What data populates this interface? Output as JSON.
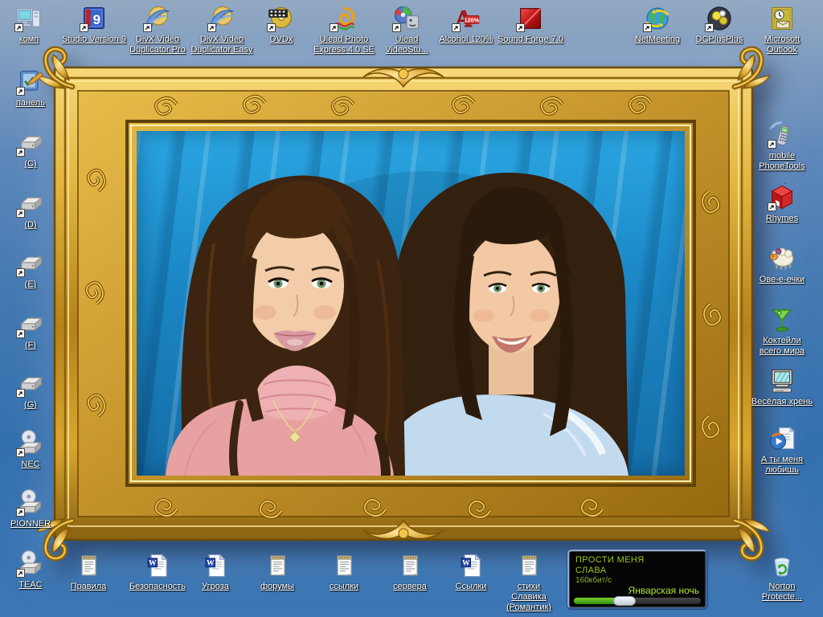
{
  "colors": {
    "bg_top": "#93a9c2",
    "bg_bottom": "#3d77b4",
    "label": "#ffffff",
    "frame_gold": "#d9a62e",
    "curtain_blue": "#1b86c4",
    "player_green": "#9cc41e",
    "player_track_green": "#b5e431"
  },
  "icons": {
    "top_row": [
      {
        "id": "komp",
        "label": "комп",
        "icon": "computer",
        "shortcut": true
      },
      {
        "id": "studio-version-9",
        "label": "Studio Version 9",
        "icon": "studio9",
        "shortcut": true
      },
      {
        "id": "divx-video-duplicator-pro",
        "label": "DivX Video Duplicator Pro",
        "icon": "divx-disc",
        "shortcut": true
      },
      {
        "id": "divx-video-duplicator-easy",
        "label": "DivX Video Duplicator Easy",
        "icon": "divx-disc",
        "shortcut": true
      },
      {
        "id": "dvdx",
        "label": "DVDx",
        "icon": "dvdx-disc",
        "shortcut": true
      },
      {
        "id": "ulead-photo-express",
        "label": "Ulead Photo Express 4.0 SE",
        "icon": "ulead-photo",
        "shortcut": true
      },
      {
        "id": "ulead-videostudio",
        "label": "Ulead VideoStu...",
        "icon": "ulead-video",
        "shortcut": true
      },
      {
        "id": "alcohol-120",
        "label": "Alcohol 120%",
        "icon": "alcohol",
        "shortcut": true
      },
      {
        "id": "sound-forge-7",
        "label": "Sound Forge 7.0",
        "icon": "soundforge",
        "shortcut": true
      },
      {
        "id": "netmeeting",
        "label": "NetMeeting",
        "icon": "netmeeting",
        "shortcut": true
      },
      {
        "id": "dcplusplus",
        "label": "DCPlusPlus",
        "icon": "dcpp",
        "shortcut": true
      },
      {
        "id": "microsoft-outlook",
        "label": "Microsoft Outlook",
        "icon": "outlook",
        "shortcut": false
      }
    ],
    "left_column": [
      {
        "id": "panel",
        "label": "панель",
        "icon": "control-panel",
        "shortcut": true
      },
      {
        "id": "drive-c",
        "label": "(C)",
        "icon": "hard-drive",
        "shortcut": true
      },
      {
        "id": "drive-d",
        "label": "(D)",
        "icon": "hard-drive",
        "shortcut": true
      },
      {
        "id": "drive-e",
        "label": "(E)",
        "icon": "hard-drive",
        "shortcut": true
      },
      {
        "id": "drive-f",
        "label": "(F)",
        "icon": "hard-drive",
        "shortcut": true
      },
      {
        "id": "drive-g",
        "label": "(G)",
        "icon": "hard-drive",
        "shortcut": true
      },
      {
        "id": "nec",
        "label": "NEC",
        "icon": "cd-drive",
        "shortcut": true
      },
      {
        "id": "pionner",
        "label": "PIONNER",
        "icon": "cd-drive",
        "shortcut": true
      },
      {
        "id": "teac",
        "label": "TEAC",
        "icon": "cd-drive",
        "shortcut": true
      }
    ],
    "right_column": [
      {
        "id": "mobile-phonetools",
        "label": "mobile PhoneTools",
        "icon": "phone",
        "shortcut": true
      },
      {
        "id": "rhymes",
        "label": "Rhymes",
        "icon": "red-cube",
        "shortcut": true
      },
      {
        "id": "sheep",
        "label": "Ове-е-ечки",
        "icon": "sheep",
        "shortcut": false
      },
      {
        "id": "cocktails",
        "label": "Коктейли всего мира",
        "icon": "martini",
        "shortcut": false
      },
      {
        "id": "fun-stuff",
        "label": "Весёлая хрень",
        "icon": "monitor-doodle",
        "shortcut": false
      },
      {
        "id": "do-you-love-me",
        "label": "А ты меня любишь",
        "icon": "player-doc",
        "shortcut": false
      },
      {
        "id": "norton-protected",
        "label": "Norton Protecte...",
        "icon": "recycle-bin",
        "shortcut": false
      }
    ],
    "bottom_row": [
      {
        "id": "pravila",
        "label": "Правила",
        "icon": "notepad",
        "shortcut": false
      },
      {
        "id": "bezopasnost",
        "label": "Безопасность",
        "icon": "word-doc",
        "shortcut": false
      },
      {
        "id": "ugroza",
        "label": "Угроза",
        "icon": "word-doc",
        "shortcut": false
      },
      {
        "id": "forumy",
        "label": "форумы",
        "icon": "notepad",
        "shortcut": false
      },
      {
        "id": "ssylki-1",
        "label": "ссылки",
        "icon": "notepad",
        "shortcut": false
      },
      {
        "id": "servera",
        "label": "сервера",
        "icon": "notepad",
        "shortcut": false
      },
      {
        "id": "ssylki-2",
        "label": "Ссылки",
        "icon": "word-doc",
        "shortcut": false
      },
      {
        "id": "stihi-slavika",
        "label": "стихи Славика (Романтик)",
        "icon": "notepad",
        "shortcut": false
      }
    ]
  },
  "player": {
    "line1": "ПРОСТИ МЕНЯ",
    "line2": "СЛАВА",
    "bitrate": "160кбит/с",
    "track": "Январская ночь",
    "progress_pct": 40
  }
}
